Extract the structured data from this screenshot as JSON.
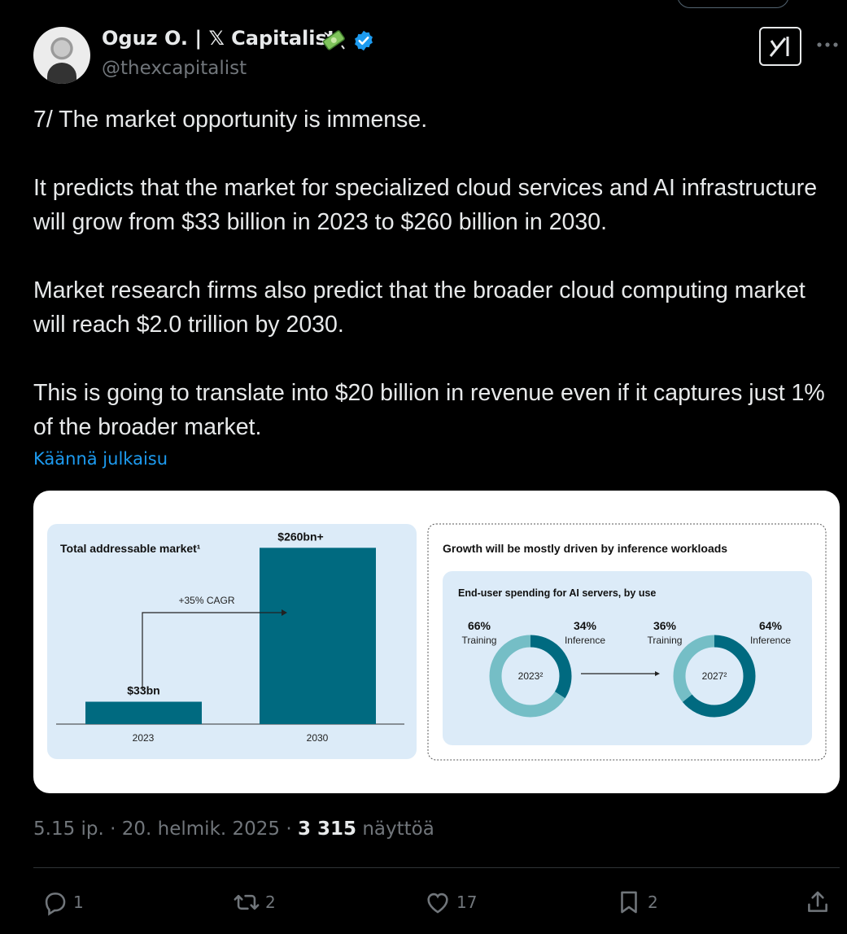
{
  "author": {
    "name": "Oguz O. | 𝕏 Capitalist",
    "handle": "@thexcapitalist"
  },
  "tweet": {
    "paragraphs": [
      "7/ The market opportunity is immense.",
      "It predicts that the market for specialized cloud services and AI infrastructure will grow from $33 billion in 2023 to $260 billion in 2030.",
      "Market research firms also predict that the broader cloud computing market will reach $2.0 trillion by 2030.",
      "This is going to translate into $20 billion in revenue even if it captures just 1% of the broader market."
    ],
    "translate_label": "Käännä julkaisu"
  },
  "meta": {
    "time": "5.15 ip.",
    "separator": " · ",
    "date": "20. helmik. 2025",
    "views_count": "3 315",
    "views_label": "näyttöä"
  },
  "actions": {
    "replies": "1",
    "reposts": "2",
    "likes": "17",
    "bookmarks": "2"
  },
  "colors": {
    "accent": "#1d9bf0",
    "chart_teal": "#006a80",
    "chart_light_teal": "#75bec6",
    "panel_bg": "#dcebf8"
  },
  "chart_data": [
    {
      "type": "bar",
      "title": "Total addressable market¹",
      "categories": [
        "2023",
        "2030"
      ],
      "values": [
        33,
        260
      ],
      "value_labels": [
        "$33bn",
        "$260bn+"
      ],
      "annotation": "+35% CAGR",
      "ylim": [
        0,
        300
      ]
    },
    {
      "type": "pie",
      "title": "Growth will be mostly driven by inference workloads",
      "subtitle": "End-user spending for AI servers, by use",
      "charts": [
        {
          "label": "2023²",
          "slices": [
            {
              "name": "Training",
              "value": 66,
              "label": "66%"
            },
            {
              "name": "Inference",
              "value": 34,
              "label": "34%"
            }
          ]
        },
        {
          "label": "2027²",
          "slices": [
            {
              "name": "Training",
              "value": 36,
              "label": "36%"
            },
            {
              "name": "Inference",
              "value": 64,
              "label": "64%"
            }
          ]
        }
      ]
    }
  ]
}
